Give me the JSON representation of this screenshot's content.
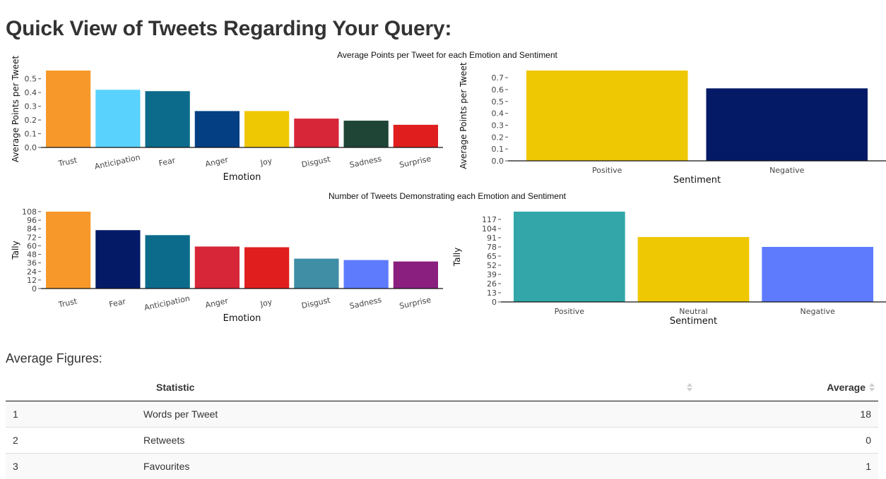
{
  "page": {
    "title": "Quick View of Tweets Regarding Your Query:",
    "captions": {
      "avg": "Average Points per Tweet for each Emotion and Sentiment",
      "count": "Number of Tweets Demonstrating each Emotion and Sentiment"
    }
  },
  "chart_data": [
    {
      "id": "avg-emotion",
      "type": "bar",
      "xlabel": "Emotion",
      "ylabel": "Average Points per Tweet",
      "categories": [
        "Trust",
        "Anticipation",
        "Fear",
        "Anger",
        "Joy",
        "Disgust",
        "Sadness",
        "Surprise"
      ],
      "values": [
        0.56,
        0.42,
        0.41,
        0.265,
        0.265,
        0.21,
        0.195,
        0.165
      ],
      "colors": [
        "#F7992A",
        "#59D2FE",
        "#0C6B8B",
        "#043F83",
        "#EFC804",
        "#D72638",
        "#1E4535",
        "#E01E1E"
      ],
      "ylim": [
        0,
        0.56
      ],
      "yticks": [
        "0.0",
        "0.1",
        "0.2",
        "0.3",
        "0.4",
        "0.5"
      ],
      "ytick_values": [
        0,
        0.1,
        0.2,
        0.3,
        0.4,
        0.5
      ],
      "rotate_xticks": true
    },
    {
      "id": "avg-sentiment",
      "type": "bar",
      "xlabel": "Sentiment",
      "ylabel": "Average Points per Tweet",
      "categories": [
        "Positive",
        "Negative"
      ],
      "values": [
        0.76,
        0.61
      ],
      "colors": [
        "#EFC804",
        "#041A67"
      ],
      "ylim": [
        0,
        0.76
      ],
      "yticks": [
        "0.0",
        "0.1",
        "0.2",
        "0.3",
        "0.4",
        "0.5",
        "0.6",
        "0.7"
      ],
      "ytick_values": [
        0,
        0.1,
        0.2,
        0.3,
        0.4,
        0.5,
        0.6,
        0.7
      ],
      "rotate_xticks": false
    },
    {
      "id": "count-emotion",
      "type": "bar",
      "xlabel": "Emotion",
      "ylabel": "Tally",
      "categories": [
        "Trust",
        "Fear",
        "Anticipation",
        "Anger",
        "Joy",
        "Disgust",
        "Sadness",
        "Surprise"
      ],
      "values": [
        108,
        82,
        75,
        59,
        58,
        42,
        40,
        38
      ],
      "colors": [
        "#F7992A",
        "#041A67",
        "#0C6B8B",
        "#D72638",
        "#E01E1E",
        "#408EA6",
        "#5E7BFE",
        "#8A1F7F"
      ],
      "ylim": [
        0,
        108
      ],
      "yticks": [
        "0",
        "12",
        "24",
        "36",
        "48",
        "60",
        "72",
        "84",
        "96",
        "108"
      ],
      "ytick_values": [
        0,
        12,
        24,
        36,
        48,
        60,
        72,
        84,
        96,
        108
      ],
      "rotate_xticks": true
    },
    {
      "id": "count-sentiment",
      "type": "bar",
      "xlabel": "Sentiment",
      "ylabel": "Tally",
      "categories": [
        "Positive",
        "Neutral",
        "Negative"
      ],
      "values": [
        128,
        92,
        78
      ],
      "colors": [
        "#32A6A8",
        "#EFC804",
        "#5E7BFE"
      ],
      "ylim": [
        0,
        128
      ],
      "yticks": [
        "0",
        "13",
        "26",
        "39",
        "52",
        "65",
        "78",
        "91",
        "104",
        "117"
      ],
      "ytick_values": [
        0,
        13,
        26,
        39,
        52,
        65,
        78,
        91,
        104,
        117
      ],
      "rotate_xticks": false
    }
  ],
  "averages": {
    "title": "Average Figures:",
    "columns": [
      "",
      "Statistic",
      "Average"
    ],
    "rows": [
      {
        "index": "1",
        "statistic": "Words per Tweet",
        "average": "18"
      },
      {
        "index": "2",
        "statistic": "Retweets",
        "average": "0"
      },
      {
        "index": "3",
        "statistic": "Favourites",
        "average": "1"
      }
    ]
  },
  "icons": {
    "sort": "sort-arrows-icon"
  }
}
